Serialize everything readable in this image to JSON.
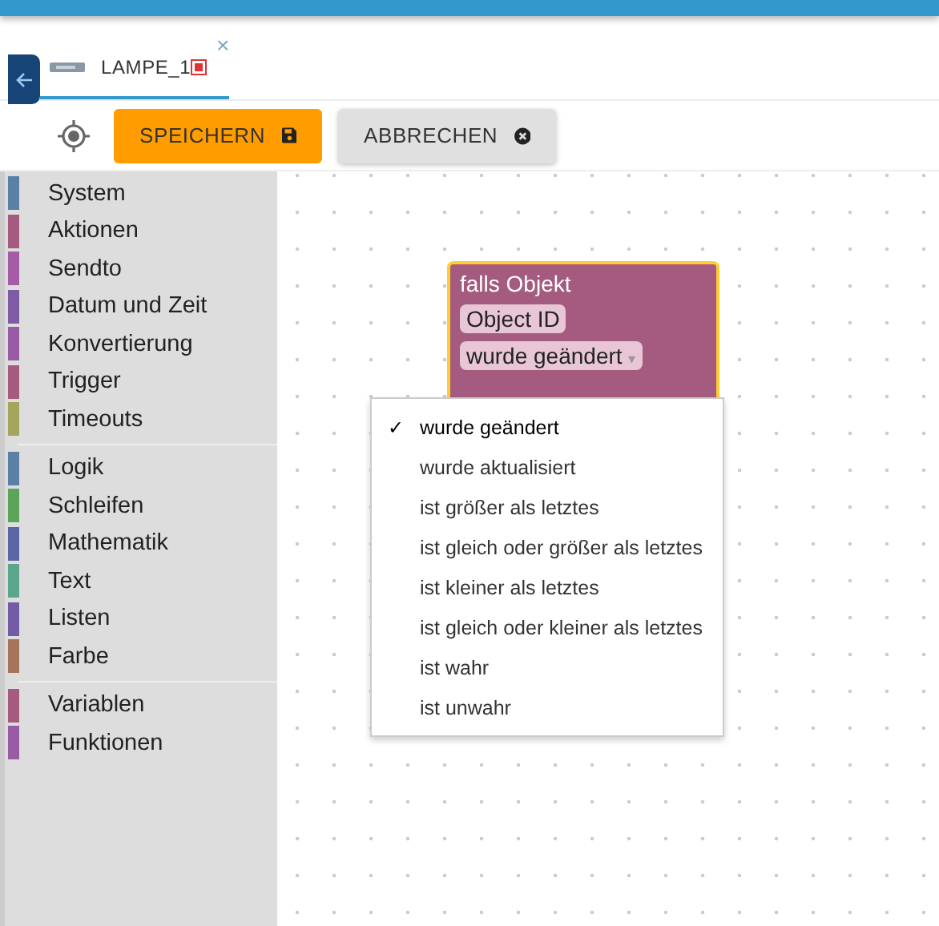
{
  "tab": {
    "label": "LAMPE_1",
    "selected": true,
    "close": "×"
  },
  "toolbar": {
    "buttons": [
      {
        "label": "SPEICHERN",
        "kind": "save"
      },
      {
        "label": "ABBRECHEN",
        "kind": "cancel"
      }
    ]
  },
  "sidebar": {
    "groups": [
      {
        "items": [
          {
            "label": "System",
            "color": "#5b80a5"
          },
          {
            "label": "Aktionen",
            "color": "#a55b80"
          },
          {
            "label": "Sendto",
            "color": "#a55ba5"
          },
          {
            "label": "Datum und Zeit",
            "color": "#805ba5"
          },
          {
            "label": "Konvertierung",
            "color": "#995ba5"
          },
          {
            "label": "Trigger",
            "color": "#a55b80"
          },
          {
            "label": "Timeouts",
            "color": "#a5a55b"
          }
        ]
      },
      {
        "items": [
          {
            "label": "Logik",
            "color": "#5b80a5"
          },
          {
            "label": "Schleifen",
            "color": "#5ba55b"
          },
          {
            "label": "Mathematik",
            "color": "#5b67a5"
          },
          {
            "label": "Text",
            "color": "#5ba58c"
          },
          {
            "label": "Listen",
            "color": "#745ba5"
          },
          {
            "label": "Farbe",
            "color": "#a5745b"
          }
        ]
      },
      {
        "items": [
          {
            "label": "Variablen",
            "color": "#a55b80"
          },
          {
            "label": "Funktionen",
            "color": "#995ba5"
          }
        ]
      }
    ]
  },
  "block": {
    "title": "falls Objekt",
    "field": "Object ID",
    "dropdown": "wurde geändert",
    "dropdown_arrow": "▾"
  },
  "menu": {
    "check": "✓",
    "items": [
      {
        "label": "wurde geändert",
        "selected": true
      },
      {
        "label": "wurde aktualisiert",
        "selected": false
      },
      {
        "label": "ist größer als letztes",
        "selected": false
      },
      {
        "label": "ist gleich oder größer als letztes",
        "selected": false
      },
      {
        "label": "ist kleiner als letztes",
        "selected": false
      },
      {
        "label": "ist gleich oder kleiner als letztes",
        "selected": false
      },
      {
        "label": "ist wahr",
        "selected": false
      },
      {
        "label": "ist unwahr",
        "selected": false
      }
    ]
  }
}
